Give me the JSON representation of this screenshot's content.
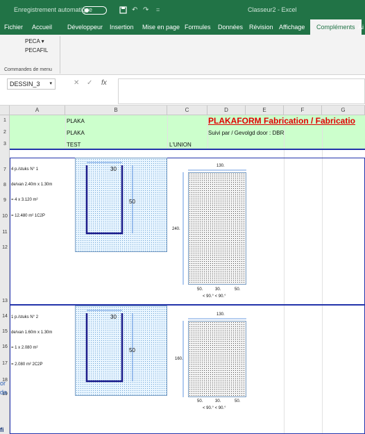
{
  "titlebar": {
    "autosave_label": "Enregistrement automatique",
    "autosave_state": "",
    "save_icon": "save-icon",
    "undo_icon": "undo-icon",
    "redo_icon": "redo-icon",
    "customize_glyph": "=",
    "filename": "Classeur2 - Excel"
  },
  "ribbon_tabs": [
    "Fichier",
    "Accueil",
    "Développeur",
    "Insertion",
    "Mise en page",
    "Formules",
    "Données",
    "Révision",
    "Affichage",
    "Compléments",
    "Ai"
  ],
  "ribbon": {
    "item1": "PECA ▾",
    "item2": "PECAFIL",
    "group_label": "Commandes de menu"
  },
  "formula_bar": {
    "name_box": "DESSIN_3",
    "name_arrow": "▾",
    "cancel": "✕",
    "enter": "✓",
    "fx": "fx",
    "formula_value": ""
  },
  "columns": [
    "A",
    "B",
    "C",
    "D",
    "E",
    "F",
    "G"
  ],
  "rows": [
    "1",
    "2",
    "3",
    "7",
    "8",
    "9",
    "10",
    "11",
    "12",
    "13",
    "14",
    "15",
    "16",
    "17",
    "18",
    "19"
  ],
  "header": {
    "b1": "PLAKA",
    "b2": "PLAKA",
    "b3": "TEST",
    "c3": "L'UNION",
    "title": "PLAKAFORM Fabrication / Fabricatio",
    "d2": "Suivi par / Gevolgd door : DBR"
  },
  "block1": {
    "qty": "4 p./stuks N° 1",
    "size": "de/van  2.40m x  1.30m",
    "area": "= 4 x  3.120 m²",
    "total": "=  12.480 m² 1C2P",
    "w": "30",
    "h": "50",
    "side": "240.",
    "top": "130.",
    "b1": "50.",
    "b2": "30.",
    "b3": "50.",
    "ang": "< 90.°  < 90.°"
  },
  "block2": {
    "qty": "1 p./stuks N° 2",
    "size": "de/van  1.60m x  1.30m",
    "area": "= 1 x  2.080 m²",
    "total": "=  2.080 m² 2C2P",
    "w": "30",
    "h": "50",
    "side": "160.",
    "top": "130.",
    "b1": "50.",
    "b2": "30.",
    "b3": "50.",
    "ang": "< 90.°  < 90.°"
  },
  "overlay": {
    "left1": "or",
    "left2": "da",
    "bottom": "fi"
  }
}
